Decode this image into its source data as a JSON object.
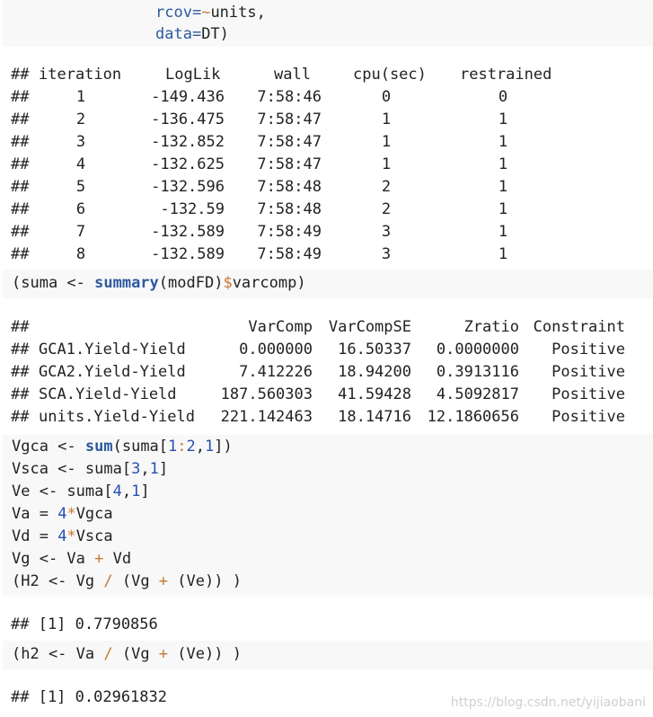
{
  "code_top": {
    "line1": {
      "arg": "rcov=",
      "op": "~",
      "rest": "units,"
    },
    "line2": {
      "arg": "data=",
      "rest": "DT)"
    }
  },
  "iterations": {
    "prefix": "##",
    "headers": [
      "iteration",
      "LogLik",
      "wall",
      "cpu(sec)",
      "restrained"
    ],
    "rows": [
      [
        "1",
        "-149.436",
        "7:58:46",
        "0",
        "0"
      ],
      [
        "2",
        "-136.475",
        "7:58:47",
        "1",
        "1"
      ],
      [
        "3",
        "-132.852",
        "7:58:47",
        "1",
        "1"
      ],
      [
        "4",
        "-132.625",
        "7:58:47",
        "1",
        "1"
      ],
      [
        "5",
        "-132.596",
        "7:58:48",
        "2",
        "1"
      ],
      [
        "6",
        "-132.59",
        "7:58:48",
        "2",
        "1"
      ],
      [
        "7",
        "-132.589",
        "7:58:49",
        "3",
        "1"
      ],
      [
        "8",
        "-132.589",
        "7:58:49",
        "3",
        "1"
      ]
    ]
  },
  "code_summary": {
    "p1": "(suma <- ",
    "fn": "summary",
    "p2": "(modFD)",
    "op": "$",
    "p3": "varcomp)"
  },
  "varcomp": {
    "prefix": "##",
    "headers": [
      "VarComp",
      "VarCompSE",
      "Zratio",
      "Constraint"
    ],
    "rows": [
      [
        "GCA1.Yield-Yield",
        "0.000000",
        "16.50337",
        "0.0000000",
        "Positive"
      ],
      [
        "GCA2.Yield-Yield",
        "7.412226",
        "18.94200",
        "0.3913116",
        "Positive"
      ],
      [
        "SCA.Yield-Yield",
        "187.560303",
        "41.59428",
        "4.5092817",
        "Positive"
      ],
      [
        "units.Yield-Yield",
        "221.142463",
        "18.14716",
        "12.1860656",
        "Positive"
      ]
    ]
  },
  "code_calc": {
    "l1": {
      "a": "Vgca <- ",
      "fn": "sum",
      "b": "(suma[",
      "n1": "1",
      "c": ":",
      "n2": "2",
      "d": ",",
      "n3": "1",
      "e": "])"
    },
    "l2": {
      "a": "Vsca <- suma[",
      "n1": "3",
      "b": ",",
      "n2": "1",
      "c": "]"
    },
    "l3": {
      "a": "Ve <- suma[",
      "n1": "4",
      "b": ",",
      "n2": "1",
      "c": "]"
    },
    "l4": {
      "a": "Va = ",
      "n": "4",
      "op": "*",
      "b": "Vgca"
    },
    "l5": {
      "a": "Vd = ",
      "n": "4",
      "op": "*",
      "b": "Vsca"
    },
    "l6": {
      "a": "Vg <- Va ",
      "op": "+",
      "b": " Vd"
    },
    "l7": {
      "a": "(H2 <- Vg ",
      "op1": "/",
      "b": " (Vg ",
      "op2": "+",
      "c": " (Ve)) )"
    }
  },
  "out_h2": "## [1] 0.7790856",
  "code_h2": {
    "a": "(h2 <- Va ",
    "op1": "/",
    "b": " (Vg ",
    "op2": "+",
    "c": " (Ve)) )"
  },
  "out_h2_lower": "## [1] 0.02961832",
  "watermark": "https://blog.csdn.net/yijiaobani"
}
